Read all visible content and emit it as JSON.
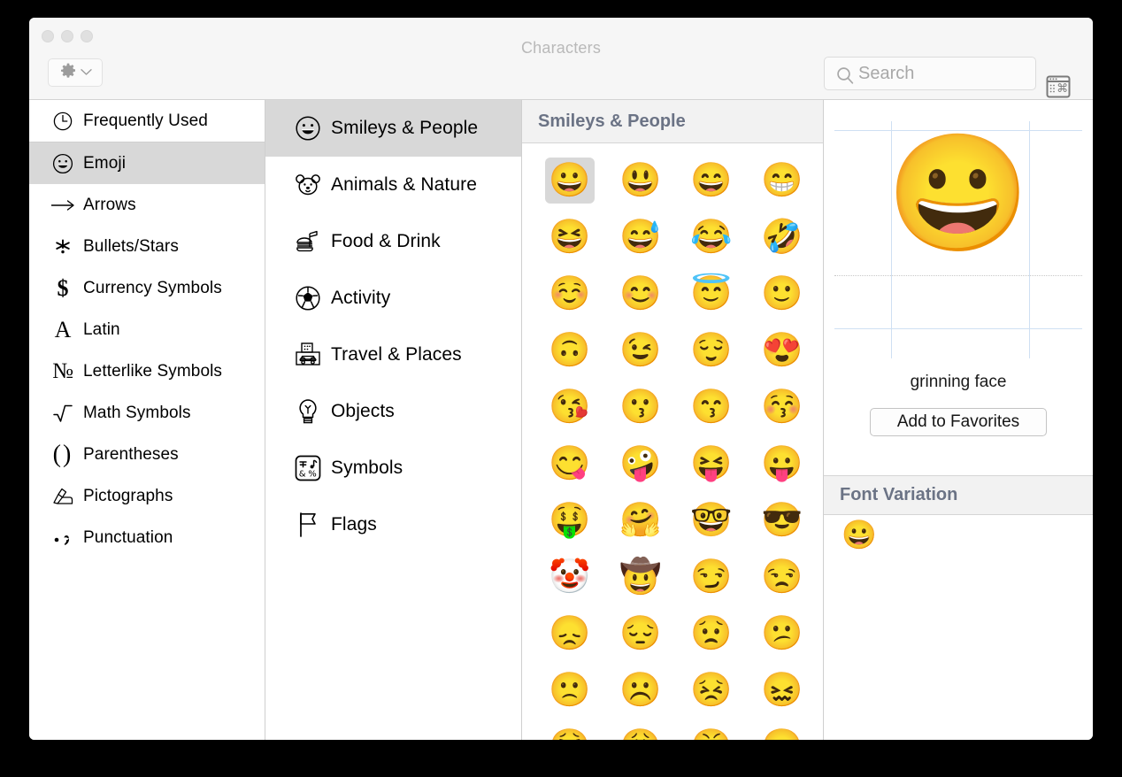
{
  "window": {
    "title": "Characters",
    "traffic_lights": [
      "close-button",
      "minimize-button",
      "zoom-button"
    ]
  },
  "toolbar": {
    "gear_icon": "gear-icon",
    "gear_chevron": "chevron-down-icon",
    "search": {
      "icon": "search-icon",
      "value": "",
      "placeholder": "Search"
    },
    "palette_toggle_icon": "character-palette-icon"
  },
  "sidebar": {
    "items": [
      {
        "label": "Frequently Used",
        "icon": "clock-icon",
        "glyph": "◴",
        "selected": false
      },
      {
        "label": "Emoji",
        "icon": "smiley-outline-icon",
        "glyph": "☻",
        "selected": true
      },
      {
        "label": "Arrows",
        "icon": "arrow-right-icon",
        "glyph": "⟶",
        "selected": false
      },
      {
        "label": "Bullets/Stars",
        "icon": "asterisk-icon",
        "glyph": "✳",
        "selected": false
      },
      {
        "label": "Currency Symbols",
        "icon": "dollar-sign-icon",
        "glyph": "$",
        "selected": false
      },
      {
        "label": "Latin",
        "icon": "letter-a-icon",
        "glyph": "A",
        "selected": false
      },
      {
        "label": "Letterlike Symbols",
        "icon": "numero-sign-icon",
        "glyph": "№",
        "selected": false
      },
      {
        "label": "Math Symbols",
        "icon": "square-root-icon",
        "glyph": "√",
        "selected": false
      },
      {
        "label": "Parentheses",
        "icon": "parentheses-icon",
        "glyph": "()",
        "selected": false
      },
      {
        "label": "Pictographs",
        "icon": "writing-hand-icon",
        "glyph": "✍",
        "selected": false
      },
      {
        "label": "Punctuation",
        "icon": "punctuation-icon",
        "glyph": "•,",
        "selected": false
      }
    ],
    "divider_after_index": 0
  },
  "categories": {
    "items": [
      {
        "label": "Smileys & People",
        "icon": "smiley-icon",
        "selected": true
      },
      {
        "label": "Animals & Nature",
        "icon": "bear-face-icon",
        "selected": false
      },
      {
        "label": "Food & Drink",
        "icon": "burger-drink-icon",
        "selected": false
      },
      {
        "label": "Activity",
        "icon": "soccer-ball-icon",
        "selected": false
      },
      {
        "label": "Travel & Places",
        "icon": "car-building-icon",
        "selected": false
      },
      {
        "label": "Objects",
        "icon": "lightbulb-icon",
        "selected": false
      },
      {
        "label": "Symbols",
        "icon": "symbols-box-icon",
        "selected": false
      },
      {
        "label": "Flags",
        "icon": "flag-icon",
        "selected": false
      }
    ]
  },
  "grid": {
    "header": "Smileys & People",
    "columns": 4,
    "selected_index": 0,
    "emojis": [
      "😀",
      "😃",
      "😄",
      "😁",
      "😆",
      "😅",
      "😂",
      "🤣",
      "☺️",
      "😊",
      "😇",
      "🙂",
      "🙃",
      "😉",
      "😌",
      "😍",
      "😘",
      "😗",
      "😙",
      "😚",
      "😋",
      "🤪",
      "😝",
      "😛",
      "🤑",
      "🤗",
      "🤓",
      "😎",
      "🤡",
      "🤠",
      "😏",
      "😒",
      "😞",
      "😔",
      "😟",
      "😕",
      "🙁",
      "☹️",
      "😣",
      "😖",
      "😫",
      "😩",
      "😤",
      "😠"
    ]
  },
  "preview": {
    "glyph": "😀",
    "name": "grinning face",
    "add_to_favorites_label": "Add to Favorites",
    "font_variation": {
      "header": "Font Variation",
      "variants": [
        "😀"
      ]
    }
  },
  "colors": {
    "chrome": "#f6f6f6",
    "selection": "#d8d8d8",
    "section_header_text": "#6b7385",
    "guide_line": "#cfe0f3",
    "divider": "#cfcfcf"
  }
}
